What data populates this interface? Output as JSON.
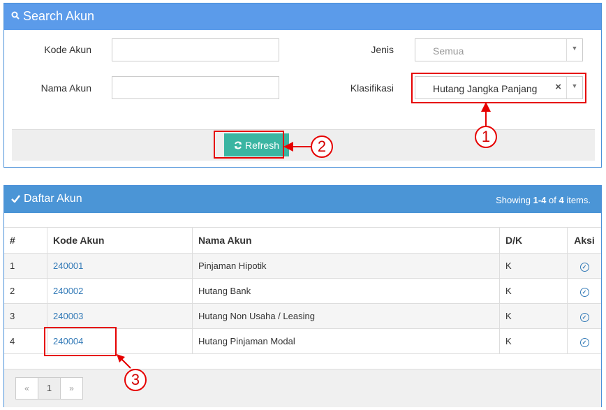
{
  "search_panel": {
    "title": "Search Akun",
    "icon": "search-icon",
    "kode_label": "Kode Akun",
    "kode_value": "",
    "nama_label": "Nama Akun",
    "nama_value": "",
    "jenis_label": "Jenis",
    "jenis_value": "Semua",
    "klasifikasi_label": "Klasifikasi",
    "klasifikasi_value": "Hutang Jangka Panjang",
    "clear_glyph": "×",
    "refresh_label": "Refresh"
  },
  "list_panel": {
    "title": "Daftar Akun",
    "showing_prefix": "Showing ",
    "showing_range": "1-4",
    "showing_of": " of ",
    "showing_total": "4",
    "showing_suffix": " items.",
    "columns": [
      "#",
      "Kode Akun",
      "Nama Akun",
      "D/K",
      "Aksi"
    ],
    "rows": [
      {
        "num": "1",
        "kode": "240001",
        "nama": "Pinjaman Hipotik",
        "dk": "K"
      },
      {
        "num": "2",
        "kode": "240002",
        "nama": "Hutang Bank",
        "dk": "K"
      },
      {
        "num": "3",
        "kode": "240003",
        "nama": "Hutang Non Usaha / Leasing",
        "dk": "K"
      },
      {
        "num": "4",
        "kode": "240004",
        "nama": "Hutang Pinjaman Modal",
        "dk": "K"
      }
    ]
  },
  "pagination": {
    "prev": "«",
    "page": "1",
    "next": "»"
  },
  "callouts": {
    "one": "1",
    "two": "2",
    "three": "3"
  },
  "colors": {
    "header": "#5b9bea",
    "refresh": "#3ab5a2",
    "highlight": "#e60000",
    "link": "#337ab7"
  }
}
